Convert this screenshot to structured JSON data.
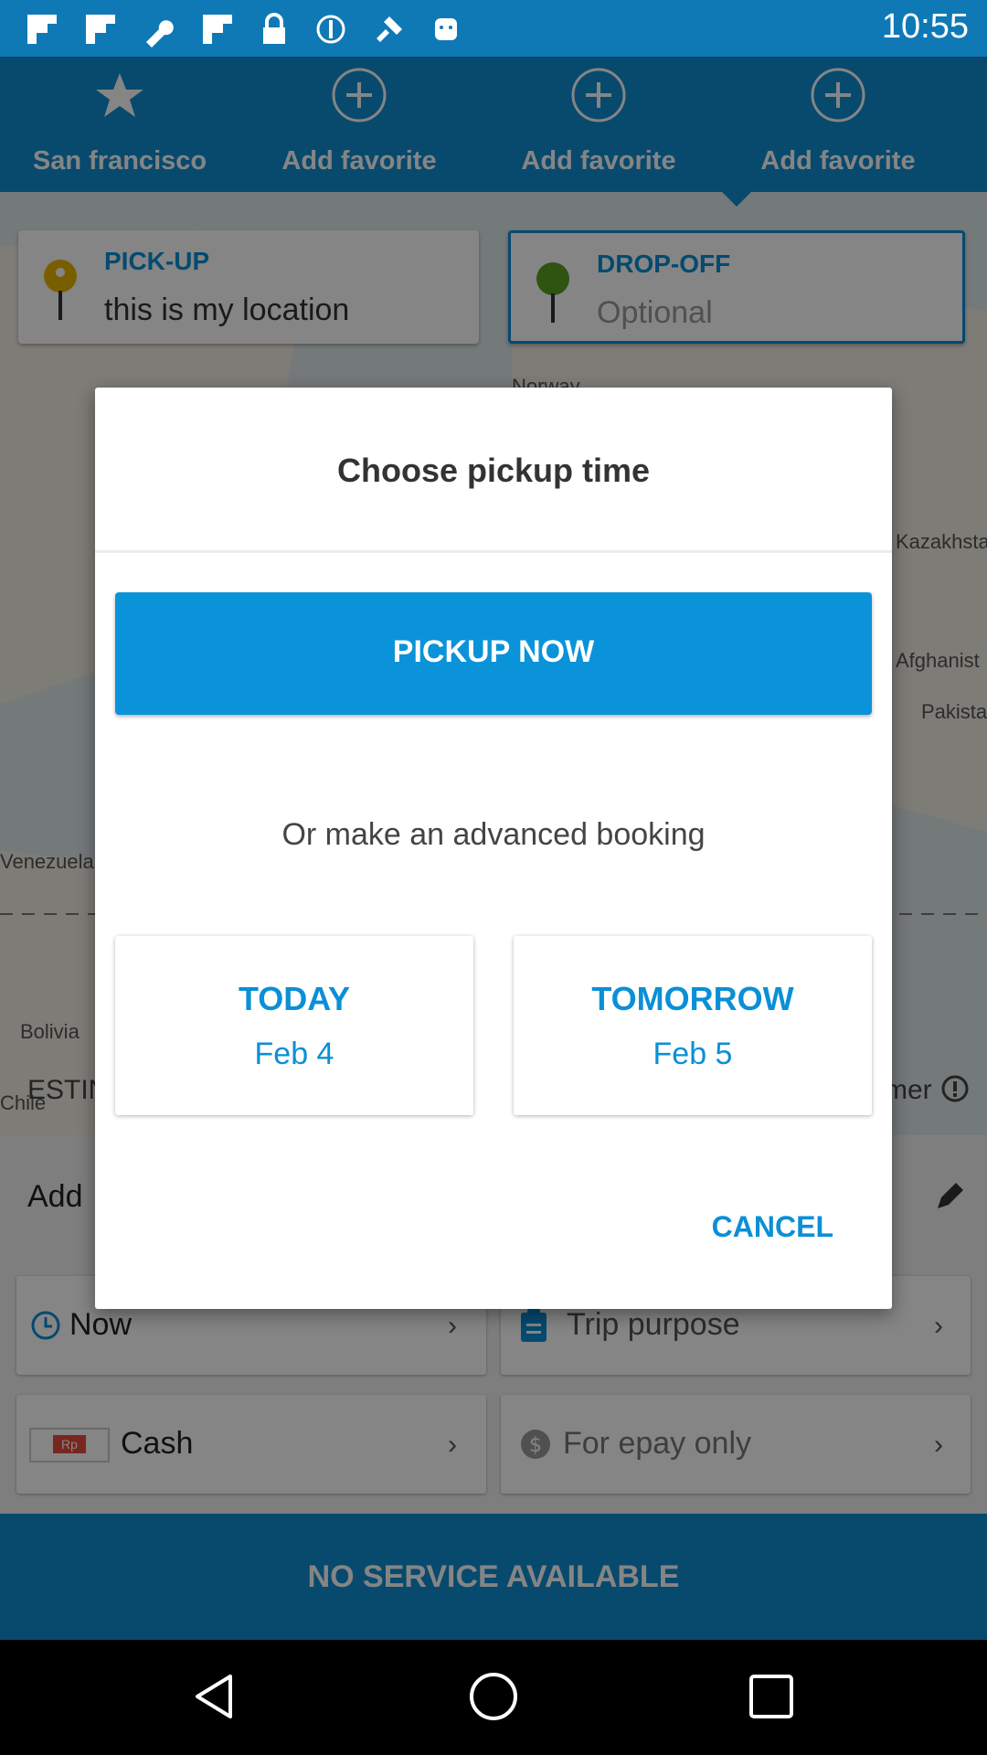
{
  "status_bar": {
    "time": "10:55",
    "icons": [
      "flipboard-icon",
      "flipboard-icon",
      "wrench-icon",
      "flipboard-icon",
      "lock-icon",
      "sync-icon",
      "fake-gps-icon",
      "android-icon"
    ]
  },
  "favorites": [
    {
      "label": "San francisco",
      "icon": "star-icon"
    },
    {
      "label": "Add favorite",
      "icon": "plus-circle-icon"
    },
    {
      "label": "Add favorite",
      "icon": "plus-circle-icon"
    },
    {
      "label": "Add favorite",
      "icon": "plus-circle-icon"
    }
  ],
  "map": {
    "labels": [
      "Norway",
      "Kazakhsta",
      "Afghanist",
      "Pakista",
      "Venezuela",
      "Bolivia",
      "Chile"
    ]
  },
  "pickup": {
    "title": "PICK-UP",
    "value": "this is my location"
  },
  "dropoff": {
    "title": "DROP-OFF",
    "placeholder": "Optional"
  },
  "estimate": {
    "left_fragment": "ESTIN",
    "right_fragment": "mer"
  },
  "add_row": {
    "label_fragment": "Add"
  },
  "options": {
    "time": "Now",
    "trip_purpose": "Trip purpose",
    "payment_badge": "Rp",
    "payment": "Cash",
    "epay": "For epay only"
  },
  "no_service": "NO SERVICE AVAILABLE",
  "dialog": {
    "title": "Choose pickup time",
    "pickup_now": "PICKUP NOW",
    "advanced": "Or make an advanced booking",
    "today": {
      "label": "TODAY",
      "date": "Feb 4"
    },
    "tomorrow": {
      "label": "TOMORROW",
      "date": "Feb 5"
    },
    "cancel": "CANCEL"
  },
  "colors": {
    "primary": "#0f8fd3",
    "accent_text": "#0b8fd6",
    "status_bar": "#0f79b6"
  }
}
